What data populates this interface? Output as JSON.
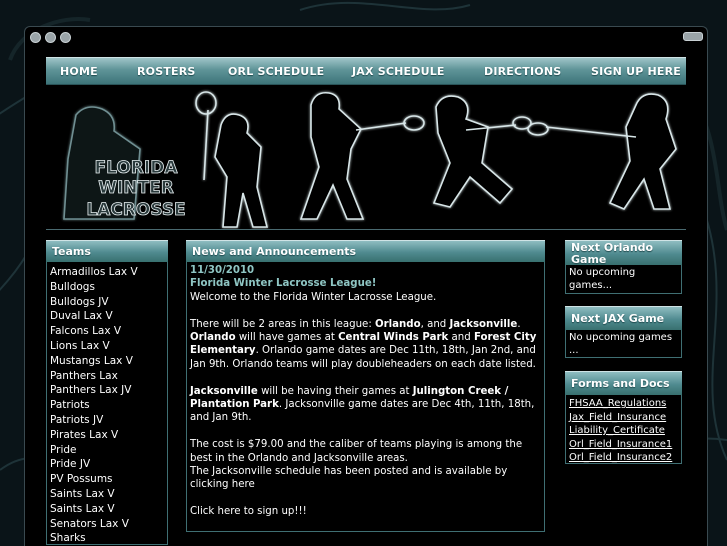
{
  "nav": {
    "items": [
      "HOME",
      "ROSTERS",
      "ORL SCHEDULE",
      "JAX SCHEDULE",
      "DIRECTIONS",
      "SIGN UP HERE"
    ]
  },
  "banner": {
    "logo_line1": "FLORIDA",
    "logo_line2": "WINTER",
    "logo_line3": "LACROSSE"
  },
  "teams": {
    "heading": "Teams",
    "items": [
      "Armadillos Lax V",
      "Bulldogs",
      "Bulldogs JV",
      "Duval Lax V",
      "Falcons Lax V",
      "Lions Lax V",
      "Mustangs Lax V",
      "Panthers Lax",
      "Panthers Lax JV",
      "Patriots",
      "Patriots JV",
      "Pirates Lax V",
      "Pride",
      "Pride JV",
      "PV Possums",
      "Saints Lax V",
      "Saints Lax V",
      "Senators Lax V",
      "Sharks"
    ]
  },
  "news": {
    "heading": "News and Announcements",
    "date": "11/30/2010",
    "title": "Florida Winter Lacrosse League!",
    "welcome": "Welcome to the Florida Winter Lacrosse League.",
    "p1_a": "There will be 2 areas in this league: ",
    "p1_orlando": "Orlando",
    "p1_b": ", and ",
    "p1_jax": "Jacksonville",
    "p1_c": ".",
    "p2_orlando": "Orlando",
    "p2_a": " will have games at ",
    "p2_cwp": "Central Winds Park",
    "p2_b": " and ",
    "p2_fce": "Forest City Elementary",
    "p2_c": ". Orlando game dates are Dec 11th, 18th, Jan 2nd, and Jan 9th. Orlando teams will play doubleheaders on each date listed.",
    "p3_jax": "Jacksonville",
    "p3_a": " will be having their games at ",
    "p3_loc": "Julington Creek / Plantation Park",
    "p3_b": ". Jacksonville game dates are Dec 4th, 11th, 18th, and Jan 9th.",
    "p4": "The cost is $79.00 and the caliber of teams playing is among the best in the Orlando and Jacksonville areas.",
    "p5": "The Jacksonville schedule has been posted and is available by clicking here",
    "p6": "Click here to sign up!!!"
  },
  "next_orlando": {
    "heading": "Next Orlando Game",
    "text": "No upcoming games..."
  },
  "next_jax": {
    "heading": "Next JAX Game",
    "text": "No upcoming games ..."
  },
  "forms": {
    "heading": "Forms and Docs",
    "items": [
      "FHSAA_Regulations",
      "Jax_Field_Insurance",
      "Liability_Certificate",
      "Orl_Field_Insurance1",
      "Orl_Field_Insurance2"
    ]
  },
  "colors": {
    "accent": "#5f9498",
    "link_title": "#8fc6c4",
    "background": "#0a1418"
  }
}
